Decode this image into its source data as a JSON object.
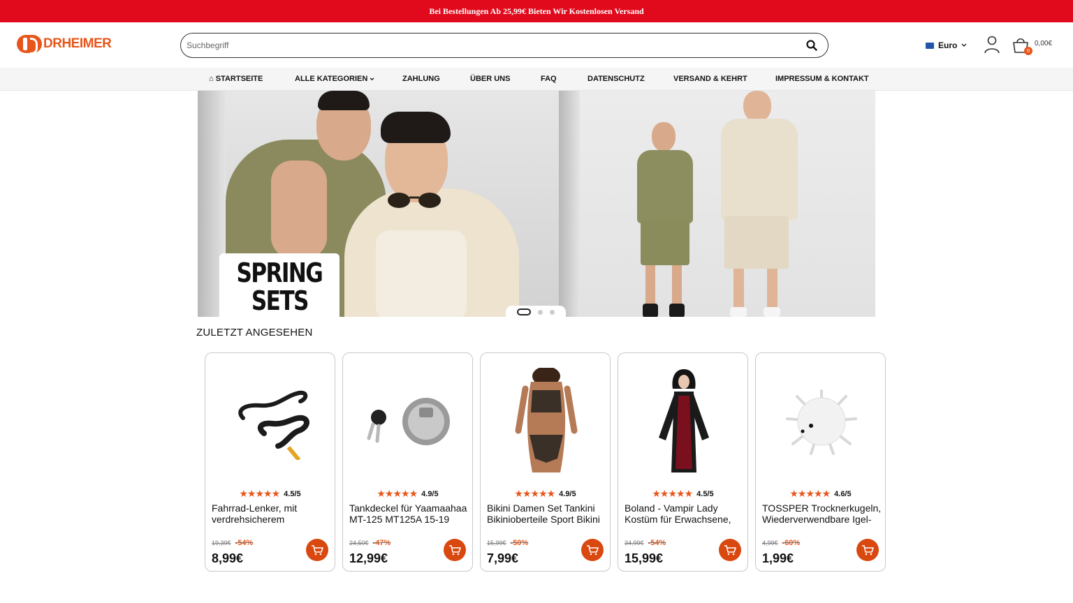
{
  "announcement": "Bei Bestellungen Ab 25,99€ Bieten Wir Kostenlosen Versand",
  "brand": {
    "logo_text": "DRHEIMER",
    "accent": "#e8561b",
    "banner_color": "#e10a1c"
  },
  "search": {
    "placeholder": "Suchbegriff",
    "value": ""
  },
  "currency": {
    "label": "Euro"
  },
  "cart": {
    "count": "0",
    "total": "0,00€"
  },
  "nav": [
    {
      "label": "Startseite",
      "icon": "home-icon"
    },
    {
      "label": "Alle Kategorien",
      "icon": "chevron-down-icon"
    },
    {
      "label": "Zahlung"
    },
    {
      "label": "Über uns"
    },
    {
      "label": "FAQ"
    },
    {
      "label": "Datenschutz"
    },
    {
      "label": "Versand & Kehrt"
    },
    {
      "label": "Impressum & Kontakt"
    }
  ],
  "hero": {
    "line1": "SPRING",
    "line2": "SETS",
    "slides": 3,
    "active_slide": 1
  },
  "recent": {
    "title": "ZULETZT ANGESEHEN",
    "products": [
      {
        "title": "Fahrrad-Lenker, mit verdrehsicherem",
        "rating": "4.5/5",
        "old_price": "19,39€",
        "discount": "-54%",
        "price": "8,99€",
        "image": "handlebar"
      },
      {
        "title": "Tankdeckel für Yaamaahaa MT-125 MT125A 15-19",
        "rating": "4.9/5",
        "old_price": "24,50€",
        "discount": "-47%",
        "price": "12,99€",
        "image": "fuel-cap"
      },
      {
        "title": "Bikini Damen Set Tankini Bikinioberteile Sport Bikini",
        "rating": "4.9/5",
        "old_price": "15,99€",
        "discount": "-50%",
        "price": "7,99€",
        "image": "bikini"
      },
      {
        "title": "Boland - Vampir Lady Kostüm für Erwachsene,",
        "rating": "4.5/5",
        "old_price": "34,99€",
        "discount": "-54%",
        "price": "15,99€",
        "image": "costume"
      },
      {
        "title": "TOSSPER Trocknerkugeln, Wiederverwendbare Igel-",
        "rating": "4.6/5",
        "old_price": "4,99€",
        "discount": "-60%",
        "price": "1,99€",
        "image": "dryer-ball"
      }
    ]
  }
}
